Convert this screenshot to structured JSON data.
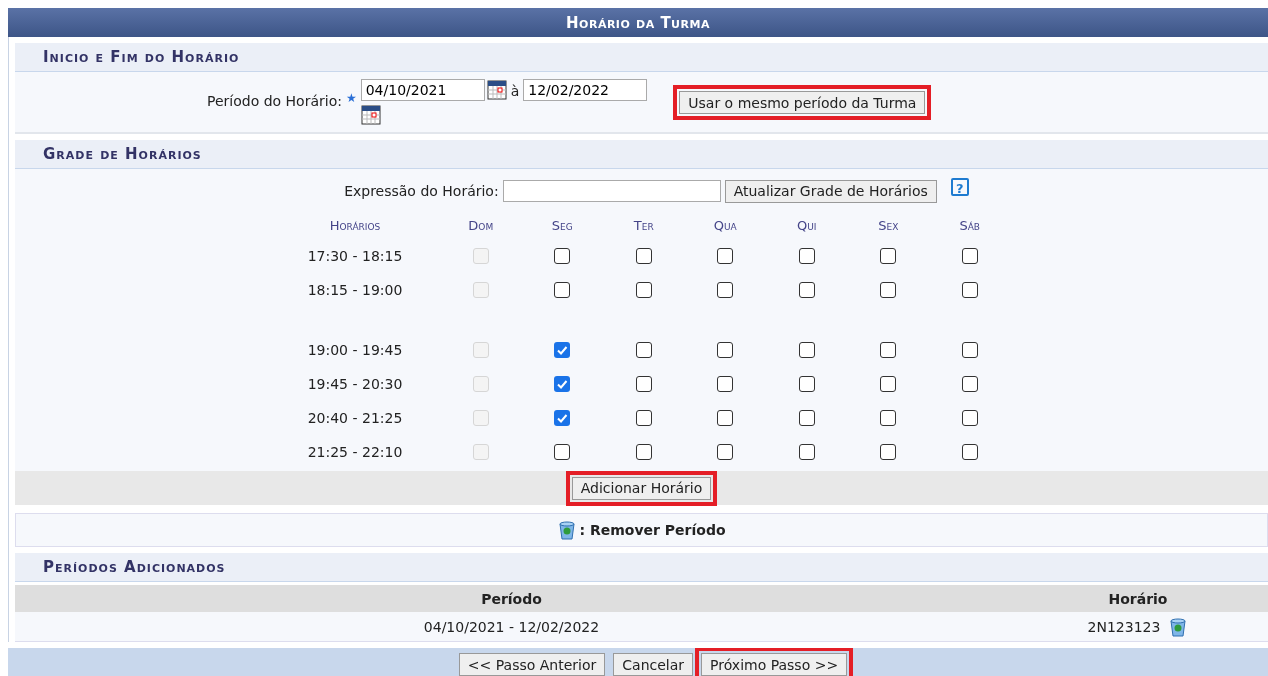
{
  "title": "Horário da Turma",
  "period_section": {
    "heading": "Inicio e Fim do Horário",
    "label": "Período do Horário:",
    "required_mark": "★",
    "start": "04/10/2021",
    "separator": "à",
    "end": "12/02/2022",
    "same_period_button": {
      "label": "Usar o mesmo período da Turma",
      "highlighted": true
    }
  },
  "grid_section": {
    "heading": "Grade de Horários",
    "expression_label": "Expressão do Horário:",
    "update_button": "Atualizar Grade de Horários",
    "help": "?",
    "time_header": "Horários",
    "days": [
      "Dom",
      "Seg",
      "Ter",
      "Qua",
      "Qui",
      "Sex",
      "Sáb"
    ],
    "row_groups": [
      {
        "rows": [
          {
            "time": "17:30 - 18:15",
            "cells": [
              {
                "checked": false,
                "disabled": true
              },
              {
                "checked": false,
                "disabled": false
              },
              {
                "checked": false,
                "disabled": false
              },
              {
                "checked": false,
                "disabled": false
              },
              {
                "checked": false,
                "disabled": false
              },
              {
                "checked": false,
                "disabled": false
              },
              {
                "checked": false,
                "disabled": false
              }
            ]
          },
          {
            "time": "18:15 - 19:00",
            "cells": [
              {
                "checked": false,
                "disabled": true
              },
              {
                "checked": false,
                "disabled": false
              },
              {
                "checked": false,
                "disabled": false
              },
              {
                "checked": false,
                "disabled": false
              },
              {
                "checked": false,
                "disabled": false
              },
              {
                "checked": false,
                "disabled": false
              },
              {
                "checked": false,
                "disabled": false
              }
            ]
          }
        ]
      },
      {
        "rows": [
          {
            "time": "19:00 - 19:45",
            "cells": [
              {
                "checked": false,
                "disabled": true
              },
              {
                "checked": true,
                "disabled": false
              },
              {
                "checked": false,
                "disabled": false
              },
              {
                "checked": false,
                "disabled": false
              },
              {
                "checked": false,
                "disabled": false
              },
              {
                "checked": false,
                "disabled": false
              },
              {
                "checked": false,
                "disabled": false
              }
            ]
          },
          {
            "time": "19:45 - 20:30",
            "cells": [
              {
                "checked": false,
                "disabled": true
              },
              {
                "checked": true,
                "disabled": false
              },
              {
                "checked": false,
                "disabled": false
              },
              {
                "checked": false,
                "disabled": false
              },
              {
                "checked": false,
                "disabled": false
              },
              {
                "checked": false,
                "disabled": false
              },
              {
                "checked": false,
                "disabled": false
              }
            ]
          },
          {
            "time": "20:40 - 21:25",
            "cells": [
              {
                "checked": false,
                "disabled": true
              },
              {
                "checked": true,
                "disabled": false
              },
              {
                "checked": false,
                "disabled": false
              },
              {
                "checked": false,
                "disabled": false
              },
              {
                "checked": false,
                "disabled": false
              },
              {
                "checked": false,
                "disabled": false
              },
              {
                "checked": false,
                "disabled": false
              }
            ]
          },
          {
            "time": "21:25 - 22:10",
            "cells": [
              {
                "checked": false,
                "disabled": true
              },
              {
                "checked": false,
                "disabled": false
              },
              {
                "checked": false,
                "disabled": false
              },
              {
                "checked": false,
                "disabled": false
              },
              {
                "checked": false,
                "disabled": false
              },
              {
                "checked": false,
                "disabled": false
              },
              {
                "checked": false,
                "disabled": false
              }
            ]
          }
        ]
      }
    ],
    "add_button": {
      "label": "Adicionar Horário",
      "highlighted": true
    }
  },
  "legend": ": Remover Período",
  "added_section": {
    "heading": "Períodos Adicionados",
    "columns": [
      "Período",
      "Horário"
    ],
    "rows": [
      {
        "period": "04/10/2021 - 12/02/2022",
        "schedule": "2N123123"
      }
    ]
  },
  "footer_buttons": [
    {
      "label": "<< Passo Anterior",
      "highlighted": false
    },
    {
      "label": "Cancelar",
      "highlighted": false
    },
    {
      "label": "Próximo Passo >>",
      "highlighted": true
    }
  ]
}
